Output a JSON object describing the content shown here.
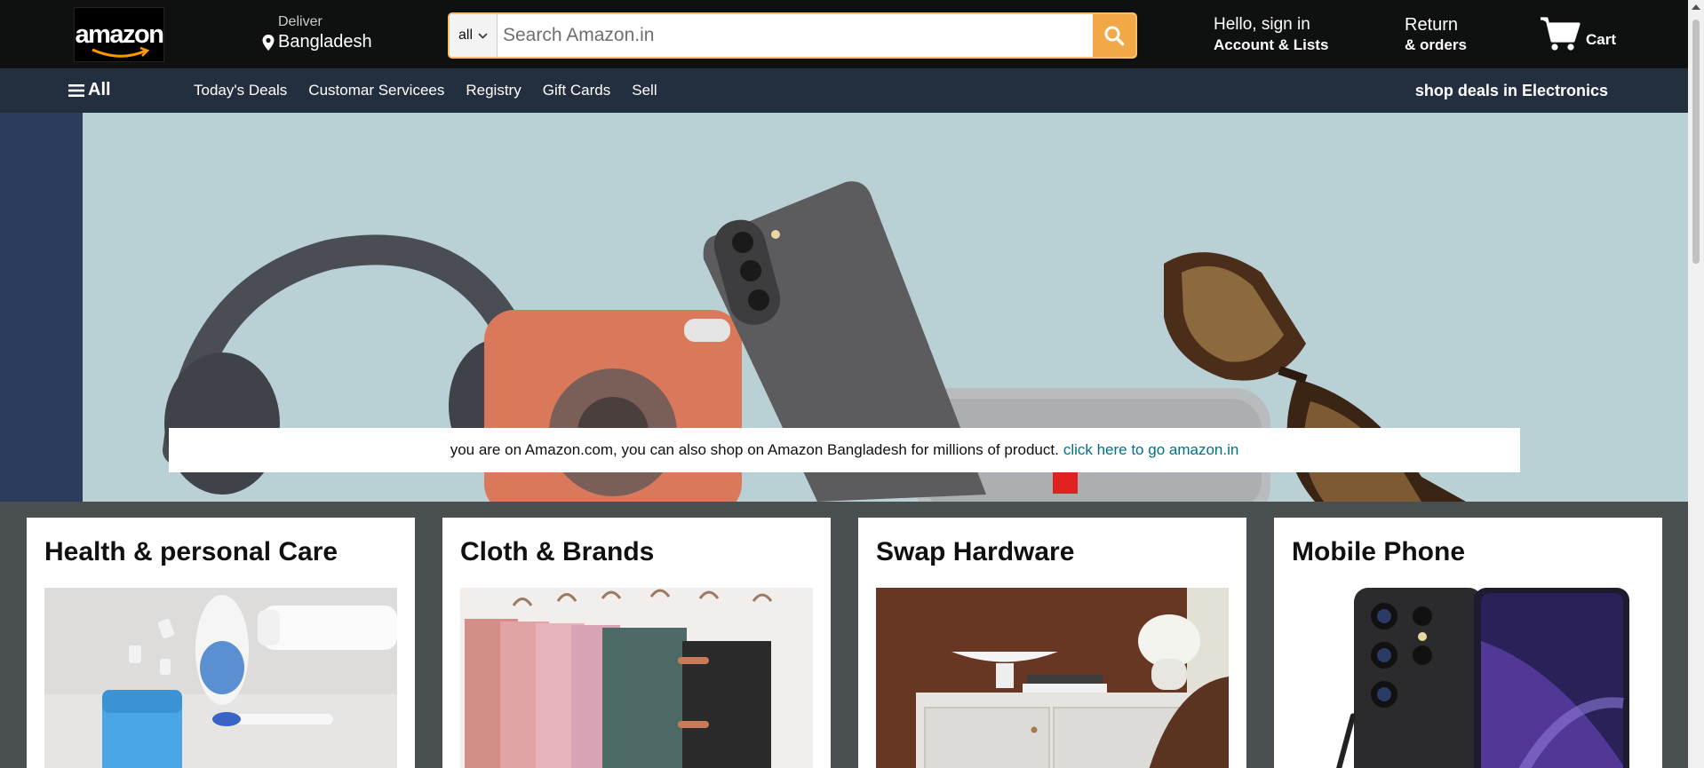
{
  "header": {
    "logo_text": "amazon",
    "deliver_label": "Deliver",
    "deliver_location": "Bangladesh",
    "search_category": "all",
    "search_placeholder": "Search Amazon.in",
    "account_line1": "Hello, sign in",
    "account_line2": "Account & Lists",
    "returns_line1": "Return",
    "returns_line2": "& orders",
    "cart_label": "Cart",
    "icons": [
      "location-pin-icon",
      "chevron-down-icon",
      "search-icon",
      "cart-icon"
    ]
  },
  "subnav": {
    "all_label": "All",
    "links": [
      "Today's Deals",
      "Customar Servicees",
      "Registry",
      "Gift Cards",
      "Sell"
    ],
    "right_label": "shop deals in Electronics"
  },
  "hero": {
    "notice_text": "you are on Amazon.com, you can also shop on Amazon Bangladesh for millions of product.",
    "notice_link": "click here to go amazon.in"
  },
  "cards": [
    {
      "title": "Health & personal Care"
    },
    {
      "title": "Cloth & Brands"
    },
    {
      "title": "Swap Hardware"
    },
    {
      "title": "Mobile Phone"
    }
  ],
  "colors": {
    "nav_bg": "#0f1111",
    "subnav_bg": "#232f3e",
    "search_button": "#f3a847",
    "link": "#007185",
    "cards_bg": "#4a5052"
  }
}
